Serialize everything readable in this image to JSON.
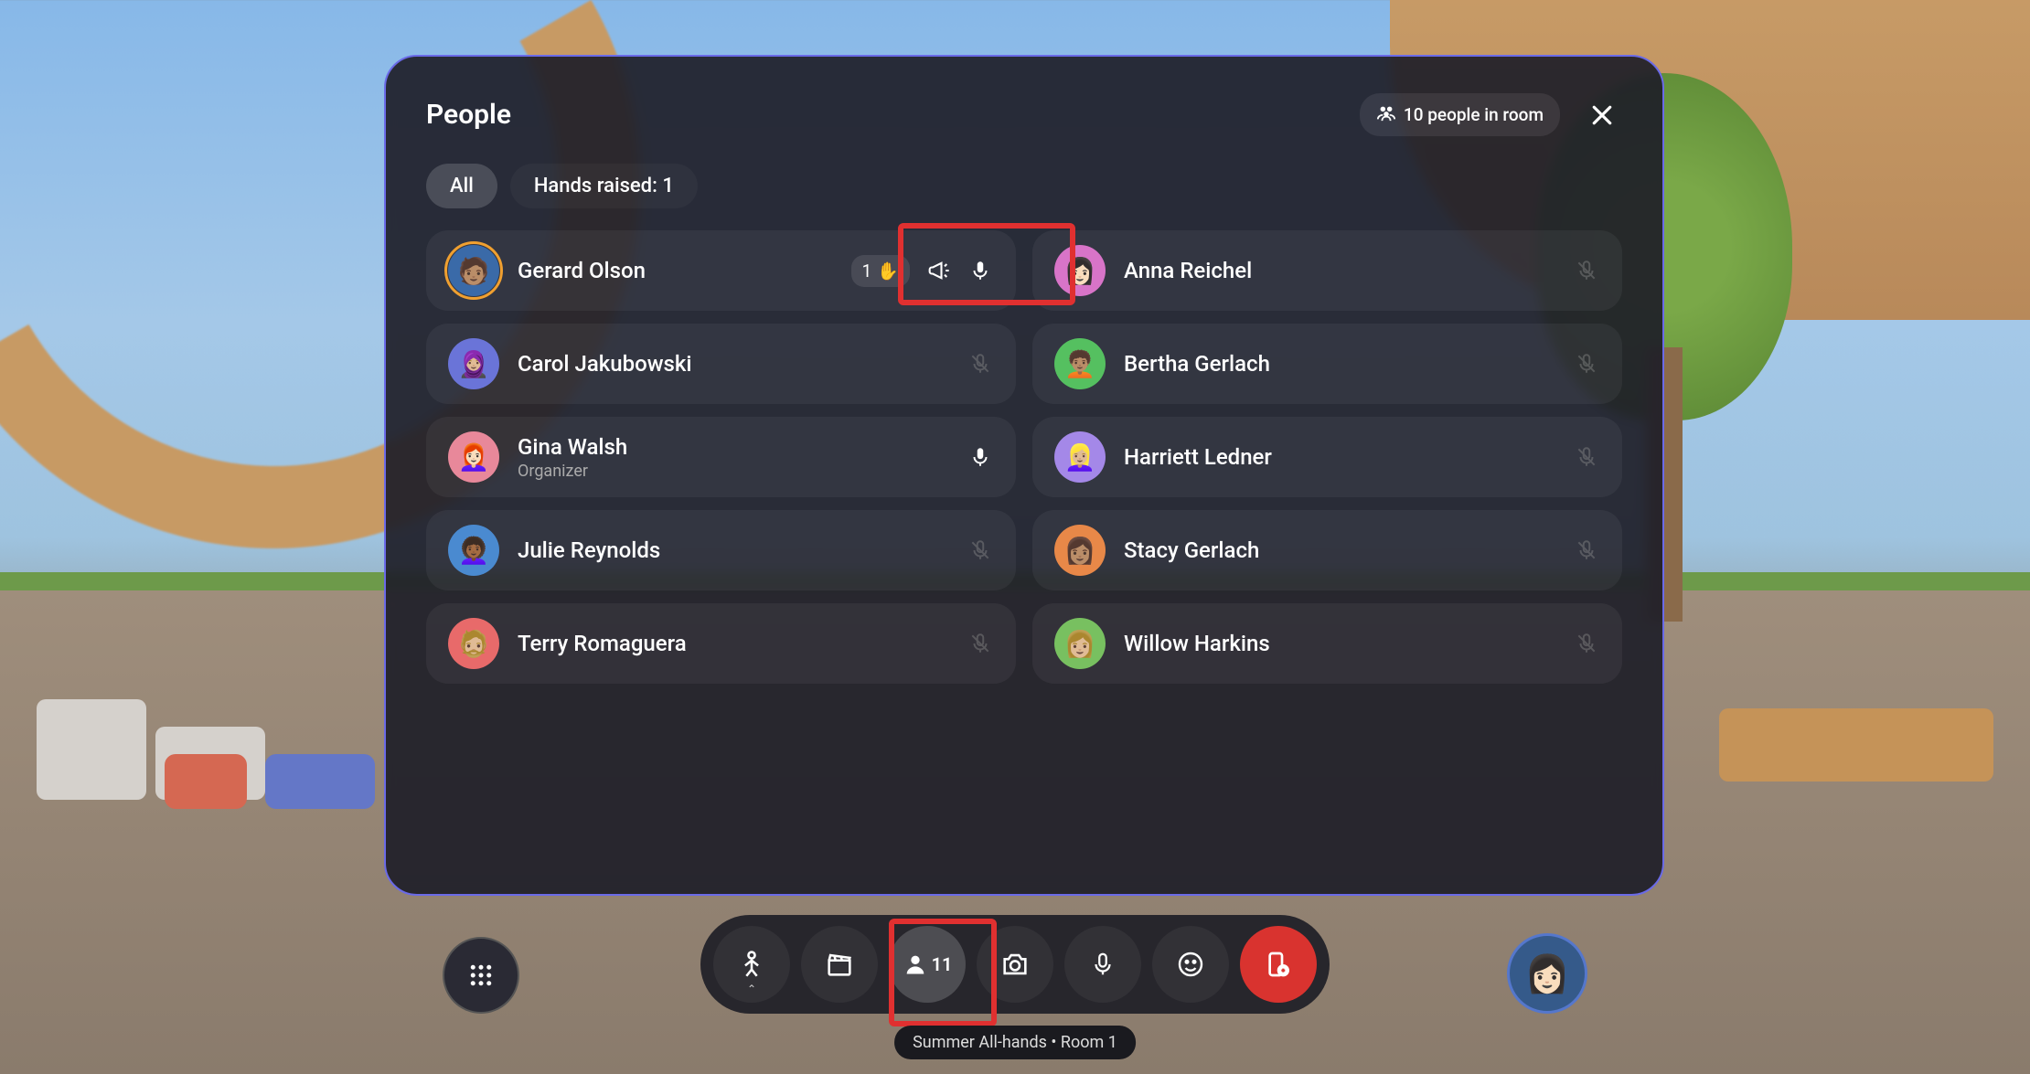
{
  "panel": {
    "title": "People",
    "room_badge": "10 people in room",
    "tabs": {
      "all": "All",
      "hands": "Hands raised: 1"
    }
  },
  "people": [
    {
      "name": "Gerard Olson",
      "subtitle": "",
      "avatar_bg": "#3a6aa8",
      "emoji": "🧑🏽",
      "hand_num": "1",
      "hand_emoji": "✋",
      "megaphone": true,
      "mic": "on",
      "ring": true
    },
    {
      "name": "Anna Reichel",
      "subtitle": "",
      "avatar_bg": "#d874c8",
      "emoji": "👩🏻",
      "mic": "muted"
    },
    {
      "name": "Carol Jakubowski",
      "subtitle": "",
      "avatar_bg": "#6a74d8",
      "emoji": "🧕🏼",
      "mic": "muted"
    },
    {
      "name": "Bertha Gerlach",
      "subtitle": "",
      "avatar_bg": "#55c060",
      "emoji": "🧑🏽‍🦱",
      "mic": "muted"
    },
    {
      "name": "Gina Walsh",
      "subtitle": "Organizer",
      "avatar_bg": "#e8889a",
      "emoji": "👩🏻‍🦰",
      "mic": "on"
    },
    {
      "name": "Harriett Ledner",
      "subtitle": "",
      "avatar_bg": "#a488e8",
      "emoji": "👱🏼‍♀️",
      "mic": "muted"
    },
    {
      "name": "Julie Reynolds",
      "subtitle": "",
      "avatar_bg": "#4a8ad0",
      "emoji": "👩🏾‍🦱",
      "mic": "muted"
    },
    {
      "name": "Stacy Gerlach",
      "subtitle": "",
      "avatar_bg": "#e88848",
      "emoji": "👩🏽",
      "mic": "muted"
    },
    {
      "name": "Terry Romaguera",
      "subtitle": "",
      "avatar_bg": "#e86a6a",
      "emoji": "🧔🏼",
      "mic": "muted"
    },
    {
      "name": "Willow Harkins",
      "subtitle": "",
      "avatar_bg": "#78c060",
      "emoji": "👩🏼",
      "mic": "muted"
    }
  ],
  "toolbar": {
    "people_count": "11"
  },
  "tooltip": "Summer All-hands • Room 1"
}
